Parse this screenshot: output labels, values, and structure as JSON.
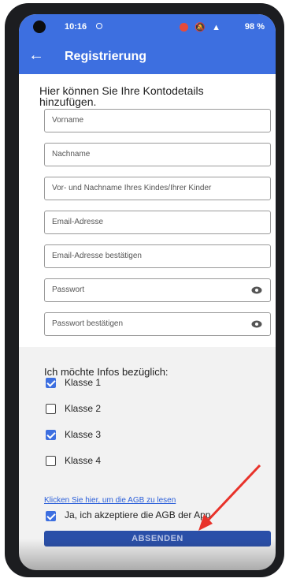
{
  "status_bar": {
    "time": "10:16",
    "battery": "98 %"
  },
  "app_bar": {
    "back_icon": "arrow-left-icon",
    "title": "Registrierung"
  },
  "intro": "Hier können Sie Ihre Kontodetails hinzufügen.",
  "form": {
    "fields": [
      {
        "placeholder": "Vorname"
      },
      {
        "placeholder": "Nachname"
      },
      {
        "placeholder": "Vor- und Nachname Ihres Kindes/Ihrer Kinder"
      },
      {
        "placeholder": "Email-Adresse"
      },
      {
        "placeholder": "Email-Adresse bestätigen"
      },
      {
        "placeholder": "Passwort",
        "icon": "eye-icon"
      },
      {
        "placeholder": "Passwort bestätigen",
        "icon": "eye-icon"
      }
    ]
  },
  "infos": {
    "title": "Ich möchte Infos bezüglich:",
    "options": [
      {
        "label": "Klasse 1",
        "checked": true
      },
      {
        "label": "Klasse 2",
        "checked": false
      },
      {
        "label": "Klasse 3",
        "checked": true
      },
      {
        "label": "Klasse 4",
        "checked": false
      }
    ]
  },
  "agb_link": "Klicken Sie hier, um die AGB zu lesen",
  "accept": {
    "label": "Ja, ich akzeptiere die AGB der App",
    "checked": true
  },
  "submit_label": "ABSENDEN",
  "colors": {
    "primary": "#3d6fe0",
    "annotation_arrow": "#e8322a"
  }
}
